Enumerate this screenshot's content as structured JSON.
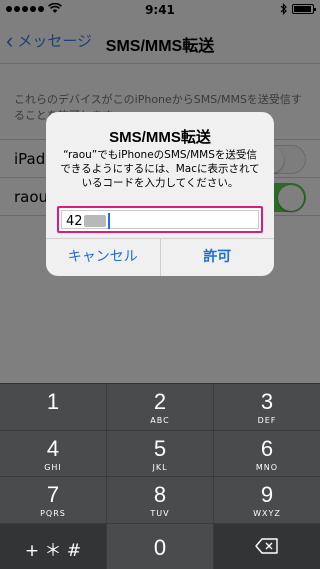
{
  "status_bar": {
    "time": "9:41"
  },
  "nav": {
    "back_label": "メッセージ",
    "title": "SMS/MMS転送"
  },
  "background": {
    "description": "これらのデバイスがこのiPhoneからSMS/MMSを送受信することを許可します",
    "rows": [
      {
        "label": "iPad",
        "toggle": "off"
      },
      {
        "label": "raou",
        "toggle": "on"
      }
    ]
  },
  "alert": {
    "title": "SMS/MMS転送",
    "message": "“raou”でもiPhoneのSMS/MMSを送受信できるようにするには、Macに表示されているコードを入力してください。",
    "code_value": "42",
    "cancel_label": "キャンセル",
    "allow_label": "許可"
  },
  "keypad": {
    "keys": [
      {
        "num": "1",
        "letters": ""
      },
      {
        "num": "2",
        "letters": "ABC"
      },
      {
        "num": "3",
        "letters": "DEF"
      },
      {
        "num": "4",
        "letters": "GHI"
      },
      {
        "num": "5",
        "letters": "JKL"
      },
      {
        "num": "6",
        "letters": "MNO"
      },
      {
        "num": "7",
        "letters": "PQRS"
      },
      {
        "num": "8",
        "letters": "TUV"
      },
      {
        "num": "9",
        "letters": "WXYZ"
      }
    ],
    "symbols_label": "+ ＊ #",
    "zero": "0"
  },
  "colors": {
    "accent": "#1b6fd6",
    "highlight_border": "#e0197a",
    "toggle_on": "#2b6a28"
  },
  "icons": {
    "delete": "backspace-icon",
    "wifi": "wifi-icon",
    "bluetooth": "bluetooth-icon",
    "battery": "battery-icon"
  }
}
